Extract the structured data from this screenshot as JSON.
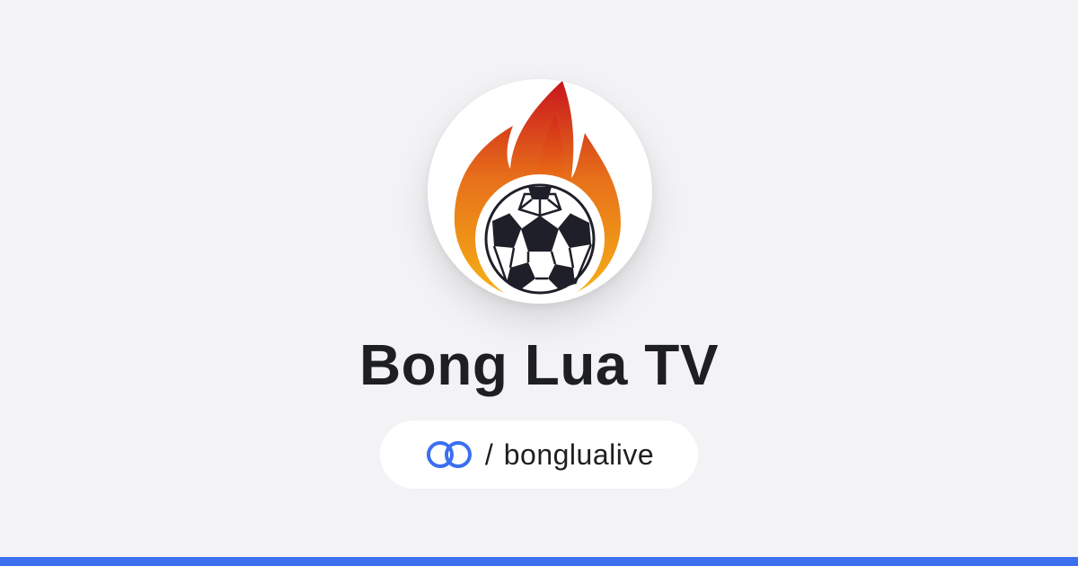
{
  "profile": {
    "name": "Bong Lua TV",
    "handle_separator": "/",
    "handle": "bonglualive",
    "avatar_icon": "flaming-soccer-ball-logo",
    "link_icon": "linked-rings-icon"
  },
  "colors": {
    "background": "#f3f3f5",
    "accent": "#3b6ff0",
    "text": "#1e1f22",
    "flame_red": "#c8161d",
    "flame_orange": "#e8711a",
    "flame_yellow": "#f5b416"
  }
}
